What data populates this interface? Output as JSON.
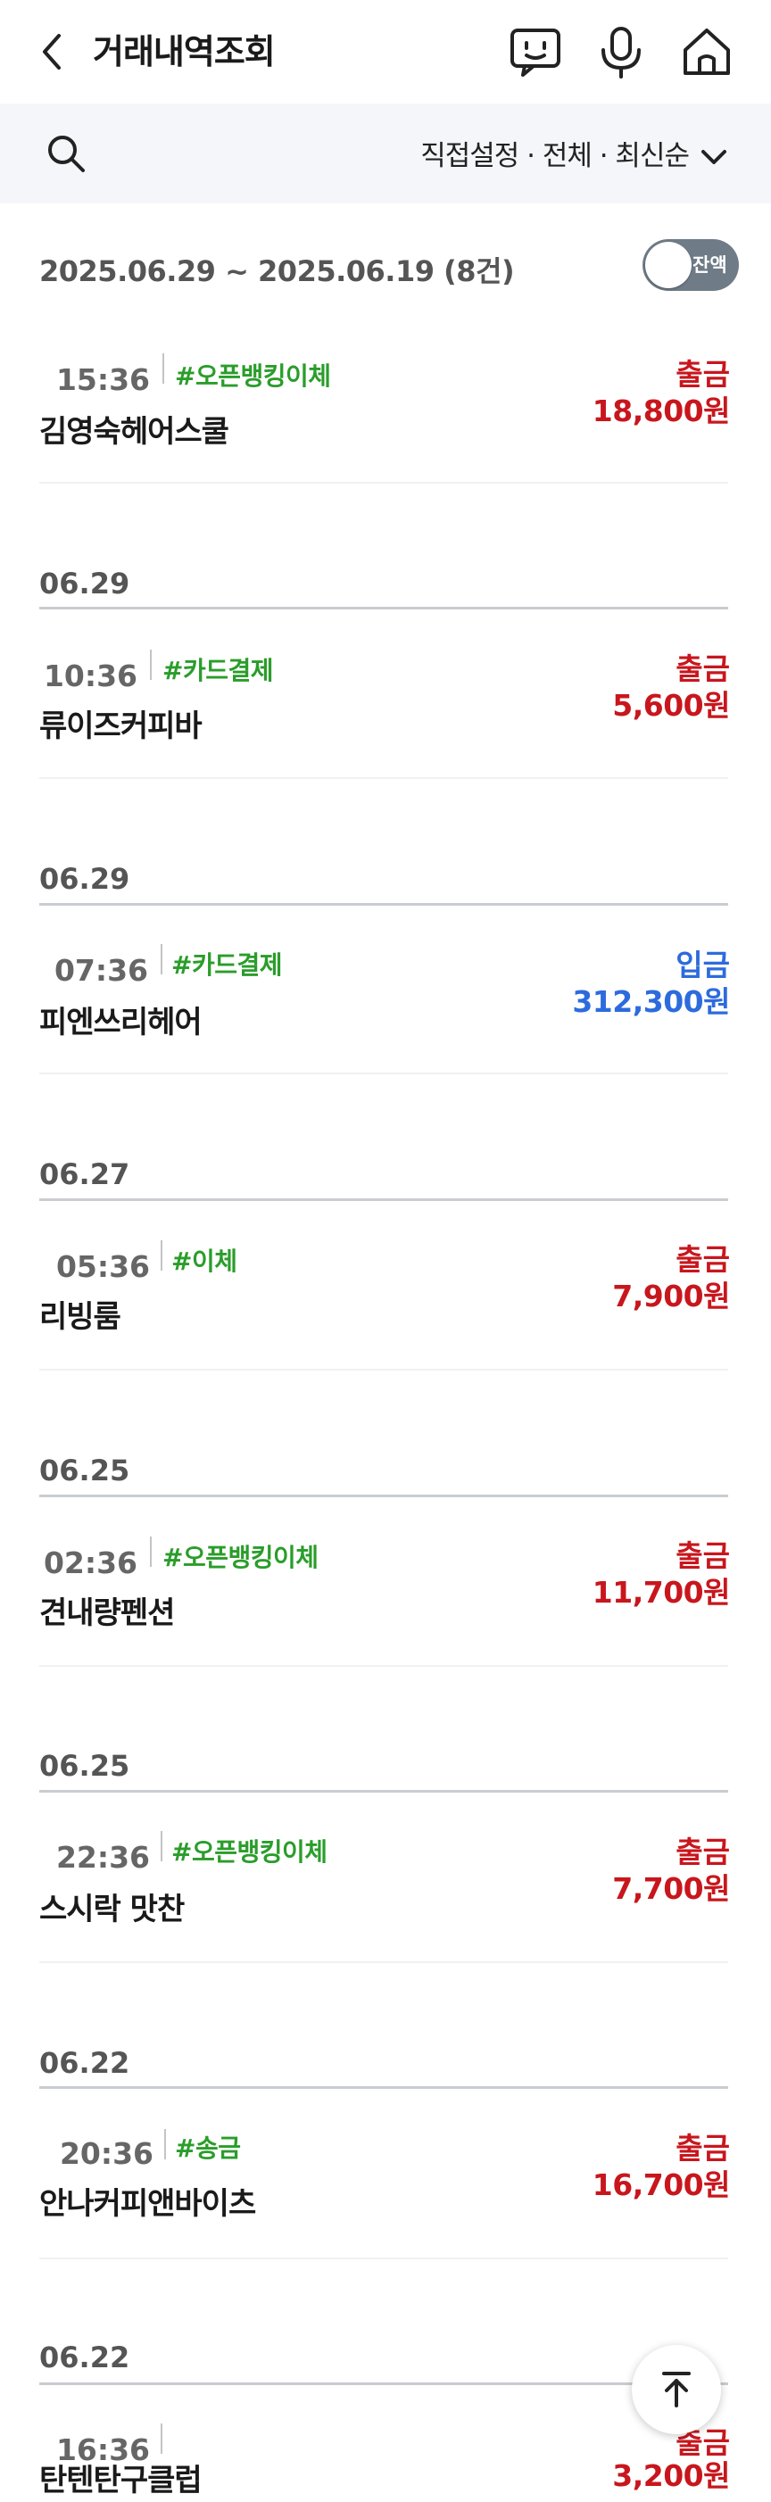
{
  "header": {
    "title": "거래내역조회"
  },
  "filter": {
    "label": "직접설정 · 전체 · 최신순"
  },
  "summary": {
    "range": "2025.06.29 ~ 2025.06.19 (8건)",
    "toggle_label": "잔액"
  },
  "colors": {
    "withdraw": "#c8161d",
    "deposit": "#2d6bdd",
    "tag": "#2a9d2a"
  },
  "groups": [
    {
      "date": "",
      "items": [
        {
          "time": "15:36",
          "tag": "#오픈뱅킹이체",
          "merchant": "김영숙헤어스쿨",
          "type": "출금",
          "amount": "18,800원"
        }
      ]
    },
    {
      "date": "06.29",
      "items": [
        {
          "time": "10:36",
          "tag": "#카드결제",
          "merchant": "류이즈커피바",
          "type": "출금",
          "amount": "5,600원"
        }
      ]
    },
    {
      "date": "06.29",
      "items": [
        {
          "time": "07:36",
          "tag": "#카드결제",
          "merchant": "피엔쓰리헤어",
          "type": "입금",
          "amount": "312,300원"
        }
      ]
    },
    {
      "date": "06.27",
      "items": [
        {
          "time": "05:36",
          "tag": "#이체",
          "merchant": "리빙룸",
          "type": "출금",
          "amount": "7,900원"
        }
      ]
    },
    {
      "date": "06.25",
      "items": [
        {
          "time": "02:36",
          "tag": "#오픈뱅킹이체",
          "merchant": "견내량펜션",
          "type": "출금",
          "amount": "11,700원"
        }
      ]
    },
    {
      "date": "06.25",
      "items": [
        {
          "time": "22:36",
          "tag": "#오픈뱅킹이체",
          "merchant": "스시락 맛찬",
          "type": "출금",
          "amount": "7,700원"
        }
      ]
    },
    {
      "date": "06.22",
      "items": [
        {
          "time": "20:36",
          "tag": "#송금",
          "merchant": "안나커피앤바이츠",
          "type": "출금",
          "amount": "16,700원"
        }
      ]
    },
    {
      "date": "06.22",
      "items": [
        {
          "time": "16:36",
          "tag": "",
          "merchant": "탄텐탄구클럽",
          "type": "출금",
          "amount": "3,200원"
        }
      ]
    }
  ],
  "icons": [
    "back-arrow-icon",
    "chat-bot-icon",
    "microphone-icon",
    "home-icon",
    "search-icon",
    "chevron-down-icon",
    "arrow-up-icon"
  ]
}
